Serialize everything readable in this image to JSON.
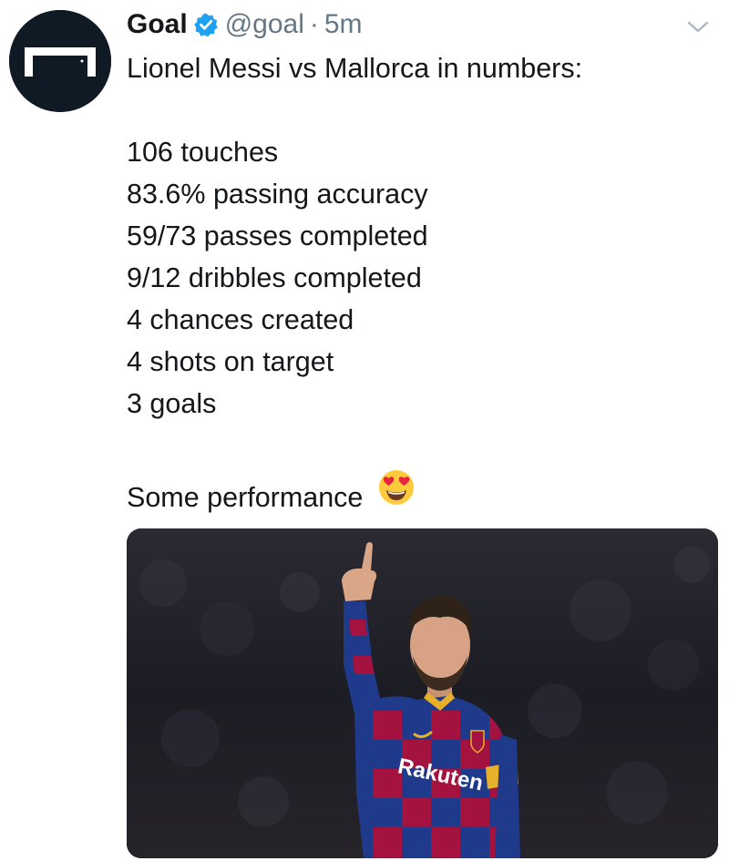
{
  "tweet": {
    "display_name": "Goal",
    "handle": "@goal",
    "separator": "·",
    "timestamp": "5m",
    "lines": [
      "Lionel Messi vs Mallorca in numbers:",
      "106 touches",
      "83.6% passing accuracy",
      "59/73 passes completed",
      "9/12 dribbles completed",
      "4 chances created",
      "4 shots on target",
      "3 goals",
      "Some performance"
    ],
    "emoji": "heart-eyes-emoji",
    "sponsor_text": "Rakuten"
  },
  "icons": {
    "avatar": "goal-logo-icon",
    "verified": "verified-badge-icon",
    "menu": "chevron-down-icon"
  },
  "colors": {
    "text": "#14171a",
    "secondary": "#657786",
    "verified": "#1da1f2",
    "avatar_bg": "#0f1a24",
    "jersey_blue": "#1f3a8a",
    "jersey_red": "#a4123f"
  }
}
